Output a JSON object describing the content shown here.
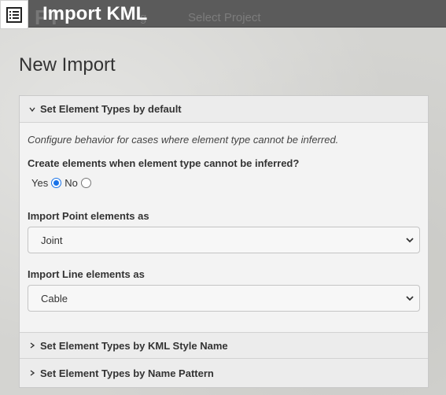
{
  "header": {
    "window_title": "Import KML",
    "background_brand": "FT",
    "background_nav": [
      "g",
      "Select Project"
    ],
    "app_icon": "list-icon"
  },
  "page": {
    "title": "New Import"
  },
  "sections": [
    {
      "title": "Set Element Types by default",
      "expanded": true,
      "hint": "Configure behavior for cases where element type cannot be inferred.",
      "create_question": "Create elements when element type cannot be inferred?",
      "radio_yes": "Yes",
      "radio_no": "No",
      "selected": "Yes",
      "point_label": "Import Point elements as",
      "point_value": "Joint",
      "line_label": "Import Line elements as",
      "line_value": "Cable"
    },
    {
      "title": "Set Element Types by KML Style Name",
      "expanded": false
    },
    {
      "title": "Set Element Types by Name Pattern",
      "expanded": false
    }
  ],
  "colors": {
    "topbar": "#5b5b5b",
    "radio_accent": "#1a73e8"
  }
}
